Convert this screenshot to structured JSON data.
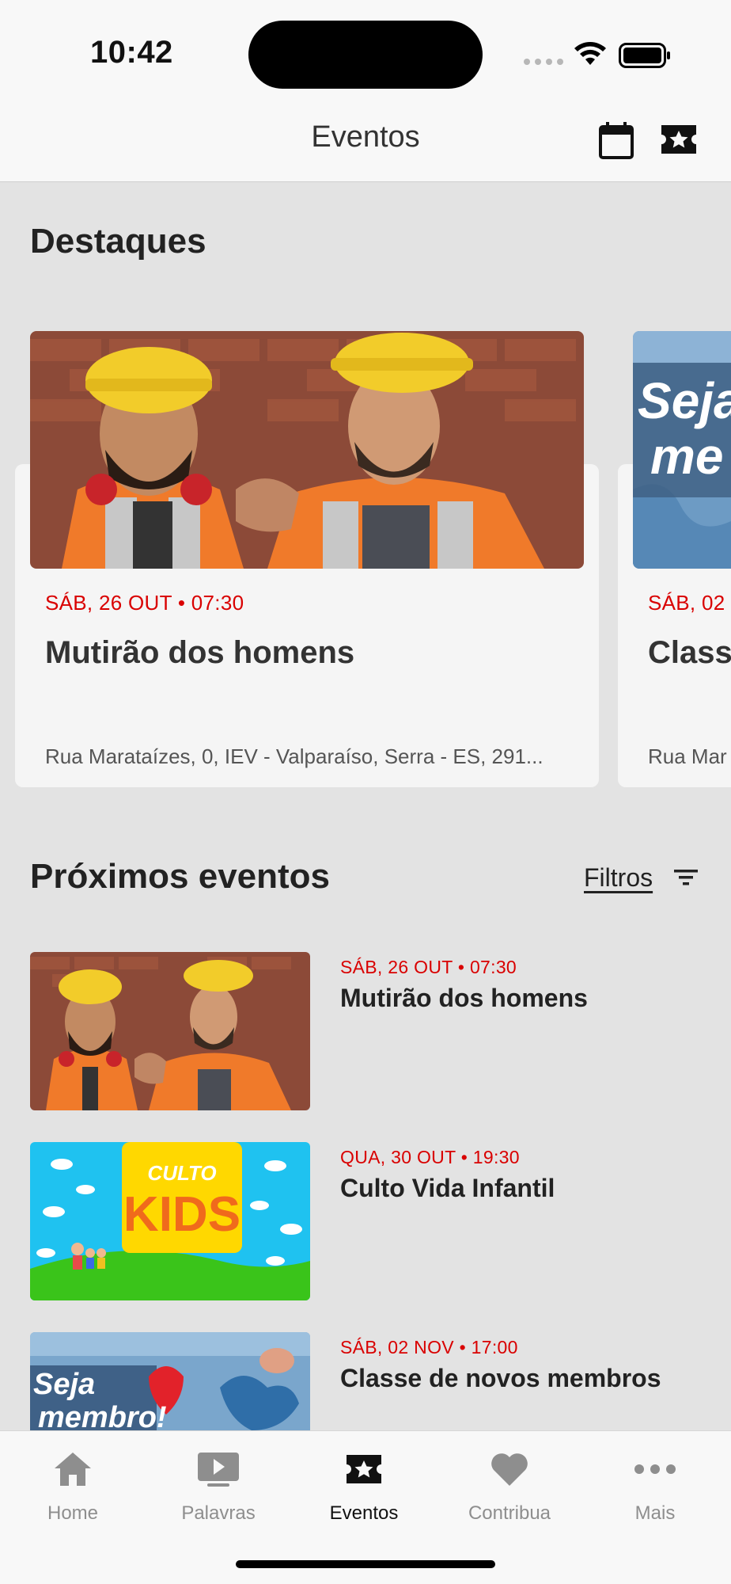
{
  "status_bar": {
    "time": "10:42"
  },
  "header": {
    "title": "Eventos"
  },
  "featured": {
    "heading": "Destaques",
    "cards": [
      {
        "date": "SÁB, 26 OUT • 07:30",
        "title": "Mutirão dos homens",
        "address": "Rua Marataízes, 0, IEV - Valparaíso, Serra - ES, 291..."
      },
      {
        "date": "SÁB, 02",
        "title": "Class",
        "address": "Rua Mar",
        "image_text_1": "Seja",
        "image_text_2": "me"
      }
    ]
  },
  "upcoming": {
    "heading": "Próximos eventos",
    "filters_label": "Filtros",
    "items": [
      {
        "date": "SÁB, 26 OUT • 07:30",
        "title": "Mutirão dos homens"
      },
      {
        "date": "QUA, 30 OUT • 19:30",
        "title": "Culto Vida Infantil",
        "image_text_1": "CULTO",
        "image_text_2": "KIDS"
      },
      {
        "date": "SÁB, 02 NOV • 17:00",
        "title": "Classe de novos membros",
        "image_text_1": "Seja",
        "image_text_2": "membro!"
      }
    ]
  },
  "tabbar": {
    "tabs": [
      {
        "label": "Home",
        "icon": "home-icon",
        "active": false
      },
      {
        "label": "Palavras",
        "icon": "play-icon",
        "active": false
      },
      {
        "label": "Eventos",
        "icon": "ticket-star-icon",
        "active": true
      },
      {
        "label": "Contribua",
        "icon": "heart-icon",
        "active": false
      },
      {
        "label": "Mais",
        "icon": "more-icon",
        "active": false
      }
    ]
  },
  "colors": {
    "accent_date": "#d90000",
    "background": "#e3e3e3",
    "bar": "#f8f8f8"
  }
}
